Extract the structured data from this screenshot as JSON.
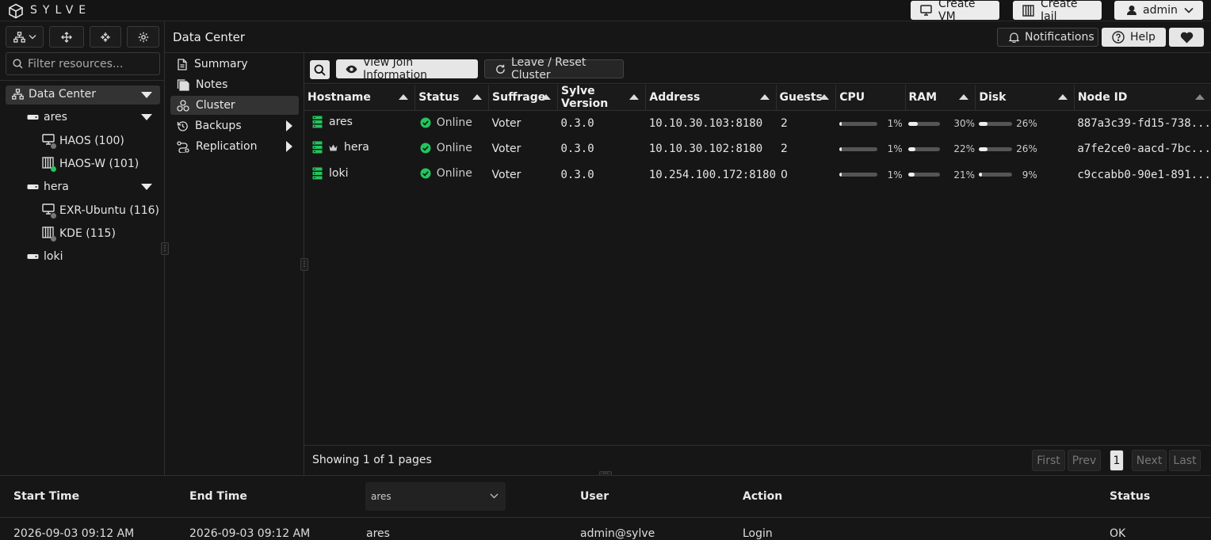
{
  "app": {
    "brand": "SYLVE"
  },
  "topbar": {
    "create_vm": "Create VM",
    "create_jail": "Create Jail",
    "user": "admin"
  },
  "left": {
    "filter_placeholder": "Filter resources...",
    "tree": [
      {
        "label": "Data Center",
        "type": "datacenter"
      },
      {
        "label": "ares",
        "type": "node"
      },
      {
        "label": "HAOS (100)",
        "type": "vm",
        "status": "stopped"
      },
      {
        "label": "HAOS-W (101)",
        "type": "jail",
        "status": "running"
      },
      {
        "label": "hera",
        "type": "node"
      },
      {
        "label": "EXR-Ubuntu (116)",
        "type": "vm",
        "status": "stopped"
      },
      {
        "label": "KDE (115)",
        "type": "jail",
        "status": "stopped"
      },
      {
        "label": "loki",
        "type": "node"
      }
    ]
  },
  "header": {
    "title": "Data Center",
    "notifications": "Notifications",
    "help": "Help"
  },
  "submenu": [
    {
      "label": "Summary"
    },
    {
      "label": "Notes"
    },
    {
      "label": "Cluster"
    },
    {
      "label": "Backups"
    },
    {
      "label": "Replication"
    }
  ],
  "toolbar": {
    "view_join": "View Join Information",
    "leave_reset": "Leave / Reset Cluster"
  },
  "table": {
    "columns": [
      "Hostname",
      "Status",
      "Suffrage",
      "Sylve Version",
      "Address",
      "Guests",
      "CPU",
      "RAM",
      "Disk",
      "Node ID"
    ],
    "rows": [
      {
        "hostname": "ares",
        "leader": false,
        "status": "Online",
        "suffrage": "Voter",
        "version": "0.3.0",
        "address": "10.10.30.103:8180",
        "guests": "2",
        "cpu": "1%",
        "cpu_v": 1,
        "ram": "30%",
        "ram_v": 30,
        "disk": "26%",
        "disk_v": 26,
        "node_id": "887a3c39-fd15-738..."
      },
      {
        "hostname": "hera",
        "leader": true,
        "status": "Online",
        "suffrage": "Voter",
        "version": "0.3.0",
        "address": "10.10.30.102:8180",
        "guests": "2",
        "cpu": "1%",
        "cpu_v": 1,
        "ram": "22%",
        "ram_v": 22,
        "disk": "26%",
        "disk_v": 26,
        "node_id": "a7fe2ce0-aacd-7bc..."
      },
      {
        "hostname": "loki",
        "leader": false,
        "status": "Online",
        "suffrage": "Voter",
        "version": "0.3.0",
        "address": "10.254.100.172:8180",
        "guests": "0",
        "cpu": "1%",
        "cpu_v": 1,
        "ram": "21%",
        "ram_v": 21,
        "disk": "9%",
        "disk_v": 9,
        "node_id": "c9ccabb0-90e1-891..."
      }
    ]
  },
  "pagination": {
    "summary": "Showing 1 of 1 pages",
    "first": "First",
    "prev": "Prev",
    "current": "1",
    "next": "Next",
    "last": "Last"
  },
  "audit": {
    "columns": {
      "start": "Start Time",
      "end": "End Time",
      "user": "User",
      "action": "Action",
      "status": "Status"
    },
    "node_select": "ares",
    "row": {
      "start": "2026-09-03 09:12 AM",
      "end": "2026-09-03 09:12 AM",
      "node": "ares",
      "user": "admin@sylve",
      "action": "Login",
      "status": "OK"
    }
  },
  "colors": {
    "online": "#22c55e",
    "node_icon": "#22c55e",
    "running_dot": "#22c55e",
    "stopped_dot": "#777777"
  }
}
